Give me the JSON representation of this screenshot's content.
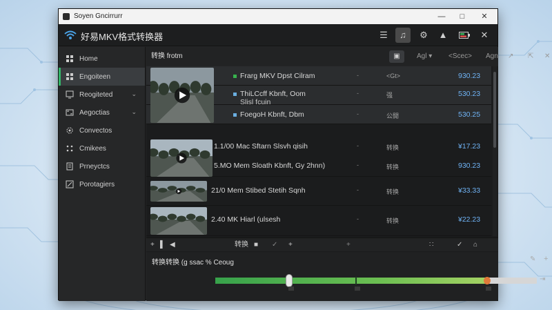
{
  "window": {
    "title": "Soyen Gncirrurr",
    "app_title": "好易MKV格式转换器"
  },
  "sidebar": {
    "items": [
      {
        "label": "Home",
        "icon": "grid-icon",
        "active": false,
        "chevron": false
      },
      {
        "label": "Engoiteen",
        "icon": "grid-icon",
        "active": true,
        "chevron": false
      },
      {
        "label": "Reogiteted",
        "icon": "monitor-icon",
        "active": false,
        "chevron": true
      },
      {
        "label": "Aegoctias",
        "icon": "aspect-icon",
        "active": false,
        "chevron": true
      },
      {
        "label": "Convectos",
        "icon": "gear-icon",
        "active": false,
        "chevron": false
      },
      {
        "label": "Cmikees",
        "icon": "dots-icon",
        "active": false,
        "chevron": false
      },
      {
        "label": "Prneyctcs",
        "icon": "document-icon",
        "active": false,
        "chevron": false
      },
      {
        "label": "Porotagiers",
        "icon": "edit-icon",
        "active": false,
        "chevron": false
      }
    ]
  },
  "toolbar": {
    "title": "转换 frotm",
    "agl": "Agl",
    "center": "<Scec>",
    "agn": "Agn"
  },
  "files": [
    {
      "name": "Frarg MKV Dpst Cilram",
      "mark": "#37b24d",
      "dash": "-",
      "status": "<Gt>",
      "size": "930.23"
    },
    {
      "name": "ThiLCcff Kbnft, Oom",
      "sub": "Slisl fcuin",
      "mark": "#6aaee0",
      "dash": "-",
      "status": "强",
      "size": "530.23"
    },
    {
      "name": "FoegoH Kbnft, Dbm",
      "mark": "#6aaee0",
      "dash": "-",
      "status": "公開",
      "size": "530.25"
    },
    {
      "name": "1.1/00 Mac Sftarn Slsvh qisih",
      "dash": "-",
      "status": "转换",
      "size": "¥17.23"
    },
    {
      "name": "5.MO Mem Sloath Kbnft, Gy 2hnn)",
      "dash": "-",
      "status": "转换",
      "size": "930.23"
    },
    {
      "name": "21/0 Mem Stibed Stetih Sqnh",
      "dash": "-",
      "status": "转换",
      "size": "¥33.33"
    },
    {
      "name": "2.40 MK Hiarl (ulsesh",
      "dash": "-",
      "status": "转换",
      "size": "¥22.23"
    }
  ],
  "bottom_toolbar": {
    "plus": "+",
    "convert": "转换",
    "plus2": "+",
    "plus3": "+"
  },
  "progress": {
    "title": "转换转换 (g ssac % Ceoug",
    "fraction": 0.845,
    "marker_fraction": 0.23,
    "tick_fraction": 0.435,
    "fill_color": "#37a24b",
    "end_knob_color": "#e07a3a"
  }
}
